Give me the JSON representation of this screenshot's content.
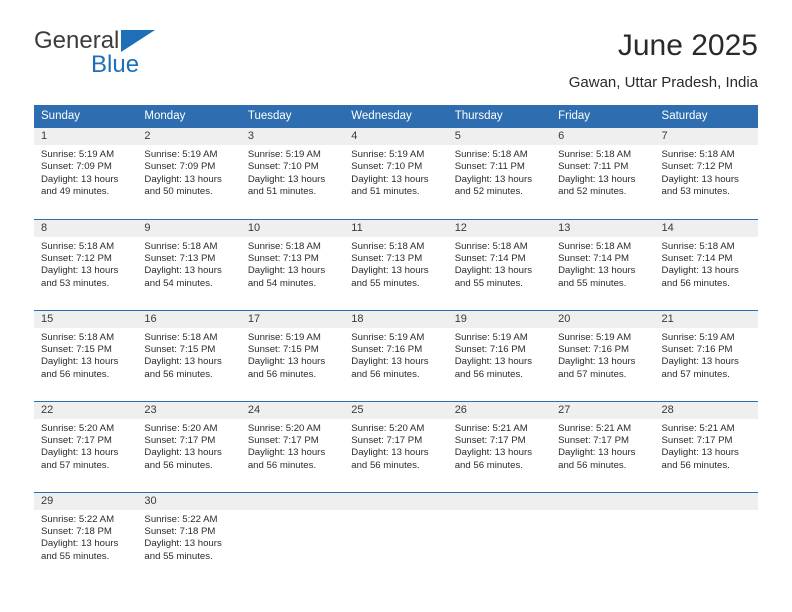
{
  "brand": {
    "name_line1": "General",
    "name_line2": "Blue",
    "flag_icon": "brand-flag-icon",
    "accent_color": "#1D70B8"
  },
  "header": {
    "title": "June 2025",
    "location": "Gawan, Uttar Pradesh, India"
  },
  "theme": {
    "header_blue": "#2E6DAF",
    "daynum_band": "#EFEFEF",
    "text": "#2B2B2B",
    "page_background": "#FFFFFF"
  },
  "weekdays": [
    "Sunday",
    "Monday",
    "Tuesday",
    "Wednesday",
    "Thursday",
    "Friday",
    "Saturday"
  ],
  "weeks": [
    [
      {
        "day": "1",
        "sunrise": "Sunrise: 5:19 AM",
        "sunset": "Sunset: 7:09 PM",
        "daylight_line1": "Daylight: 13 hours",
        "daylight_line2": "and 49 minutes."
      },
      {
        "day": "2",
        "sunrise": "Sunrise: 5:19 AM",
        "sunset": "Sunset: 7:09 PM",
        "daylight_line1": "Daylight: 13 hours",
        "daylight_line2": "and 50 minutes."
      },
      {
        "day": "3",
        "sunrise": "Sunrise: 5:19 AM",
        "sunset": "Sunset: 7:10 PM",
        "daylight_line1": "Daylight: 13 hours",
        "daylight_line2": "and 51 minutes."
      },
      {
        "day": "4",
        "sunrise": "Sunrise: 5:19 AM",
        "sunset": "Sunset: 7:10 PM",
        "daylight_line1": "Daylight: 13 hours",
        "daylight_line2": "and 51 minutes."
      },
      {
        "day": "5",
        "sunrise": "Sunrise: 5:18 AM",
        "sunset": "Sunset: 7:11 PM",
        "daylight_line1": "Daylight: 13 hours",
        "daylight_line2": "and 52 minutes."
      },
      {
        "day": "6",
        "sunrise": "Sunrise: 5:18 AM",
        "sunset": "Sunset: 7:11 PM",
        "daylight_line1": "Daylight: 13 hours",
        "daylight_line2": "and 52 minutes."
      },
      {
        "day": "7",
        "sunrise": "Sunrise: 5:18 AM",
        "sunset": "Sunset: 7:12 PM",
        "daylight_line1": "Daylight: 13 hours",
        "daylight_line2": "and 53 minutes."
      }
    ],
    [
      {
        "day": "8",
        "sunrise": "Sunrise: 5:18 AM",
        "sunset": "Sunset: 7:12 PM",
        "daylight_line1": "Daylight: 13 hours",
        "daylight_line2": "and 53 minutes."
      },
      {
        "day": "9",
        "sunrise": "Sunrise: 5:18 AM",
        "sunset": "Sunset: 7:13 PM",
        "daylight_line1": "Daylight: 13 hours",
        "daylight_line2": "and 54 minutes."
      },
      {
        "day": "10",
        "sunrise": "Sunrise: 5:18 AM",
        "sunset": "Sunset: 7:13 PM",
        "daylight_line1": "Daylight: 13 hours",
        "daylight_line2": "and 54 minutes."
      },
      {
        "day": "11",
        "sunrise": "Sunrise: 5:18 AM",
        "sunset": "Sunset: 7:13 PM",
        "daylight_line1": "Daylight: 13 hours",
        "daylight_line2": "and 55 minutes."
      },
      {
        "day": "12",
        "sunrise": "Sunrise: 5:18 AM",
        "sunset": "Sunset: 7:14 PM",
        "daylight_line1": "Daylight: 13 hours",
        "daylight_line2": "and 55 minutes."
      },
      {
        "day": "13",
        "sunrise": "Sunrise: 5:18 AM",
        "sunset": "Sunset: 7:14 PM",
        "daylight_line1": "Daylight: 13 hours",
        "daylight_line2": "and 55 minutes."
      },
      {
        "day": "14",
        "sunrise": "Sunrise: 5:18 AM",
        "sunset": "Sunset: 7:14 PM",
        "daylight_line1": "Daylight: 13 hours",
        "daylight_line2": "and 56 minutes."
      }
    ],
    [
      {
        "day": "15",
        "sunrise": "Sunrise: 5:18 AM",
        "sunset": "Sunset: 7:15 PM",
        "daylight_line1": "Daylight: 13 hours",
        "daylight_line2": "and 56 minutes."
      },
      {
        "day": "16",
        "sunrise": "Sunrise: 5:18 AM",
        "sunset": "Sunset: 7:15 PM",
        "daylight_line1": "Daylight: 13 hours",
        "daylight_line2": "and 56 minutes."
      },
      {
        "day": "17",
        "sunrise": "Sunrise: 5:19 AM",
        "sunset": "Sunset: 7:15 PM",
        "daylight_line1": "Daylight: 13 hours",
        "daylight_line2": "and 56 minutes."
      },
      {
        "day": "18",
        "sunrise": "Sunrise: 5:19 AM",
        "sunset": "Sunset: 7:16 PM",
        "daylight_line1": "Daylight: 13 hours",
        "daylight_line2": "and 56 minutes."
      },
      {
        "day": "19",
        "sunrise": "Sunrise: 5:19 AM",
        "sunset": "Sunset: 7:16 PM",
        "daylight_line1": "Daylight: 13 hours",
        "daylight_line2": "and 56 minutes."
      },
      {
        "day": "20",
        "sunrise": "Sunrise: 5:19 AM",
        "sunset": "Sunset: 7:16 PM",
        "daylight_line1": "Daylight: 13 hours",
        "daylight_line2": "and 57 minutes."
      },
      {
        "day": "21",
        "sunrise": "Sunrise: 5:19 AM",
        "sunset": "Sunset: 7:16 PM",
        "daylight_line1": "Daylight: 13 hours",
        "daylight_line2": "and 57 minutes."
      }
    ],
    [
      {
        "day": "22",
        "sunrise": "Sunrise: 5:20 AM",
        "sunset": "Sunset: 7:17 PM",
        "daylight_line1": "Daylight: 13 hours",
        "daylight_line2": "and 57 minutes."
      },
      {
        "day": "23",
        "sunrise": "Sunrise: 5:20 AM",
        "sunset": "Sunset: 7:17 PM",
        "daylight_line1": "Daylight: 13 hours",
        "daylight_line2": "and 56 minutes."
      },
      {
        "day": "24",
        "sunrise": "Sunrise: 5:20 AM",
        "sunset": "Sunset: 7:17 PM",
        "daylight_line1": "Daylight: 13 hours",
        "daylight_line2": "and 56 minutes."
      },
      {
        "day": "25",
        "sunrise": "Sunrise: 5:20 AM",
        "sunset": "Sunset: 7:17 PM",
        "daylight_line1": "Daylight: 13 hours",
        "daylight_line2": "and 56 minutes."
      },
      {
        "day": "26",
        "sunrise": "Sunrise: 5:21 AM",
        "sunset": "Sunset: 7:17 PM",
        "daylight_line1": "Daylight: 13 hours",
        "daylight_line2": "and 56 minutes."
      },
      {
        "day": "27",
        "sunrise": "Sunrise: 5:21 AM",
        "sunset": "Sunset: 7:17 PM",
        "daylight_line1": "Daylight: 13 hours",
        "daylight_line2": "and 56 minutes."
      },
      {
        "day": "28",
        "sunrise": "Sunrise: 5:21 AM",
        "sunset": "Sunset: 7:17 PM",
        "daylight_line1": "Daylight: 13 hours",
        "daylight_line2": "and 56 minutes."
      }
    ],
    [
      {
        "day": "29",
        "sunrise": "Sunrise: 5:22 AM",
        "sunset": "Sunset: 7:18 PM",
        "daylight_line1": "Daylight: 13 hours",
        "daylight_line2": "and 55 minutes."
      },
      {
        "day": "30",
        "sunrise": "Sunrise: 5:22 AM",
        "sunset": "Sunset: 7:18 PM",
        "daylight_line1": "Daylight: 13 hours",
        "daylight_line2": "and 55 minutes."
      },
      {
        "day": "",
        "sunrise": "",
        "sunset": "",
        "daylight_line1": "",
        "daylight_line2": ""
      },
      {
        "day": "",
        "sunrise": "",
        "sunset": "",
        "daylight_line1": "",
        "daylight_line2": ""
      },
      {
        "day": "",
        "sunrise": "",
        "sunset": "",
        "daylight_line1": "",
        "daylight_line2": ""
      },
      {
        "day": "",
        "sunrise": "",
        "sunset": "",
        "daylight_line1": "",
        "daylight_line2": ""
      },
      {
        "day": "",
        "sunrise": "",
        "sunset": "",
        "daylight_line1": "",
        "daylight_line2": ""
      }
    ]
  ]
}
